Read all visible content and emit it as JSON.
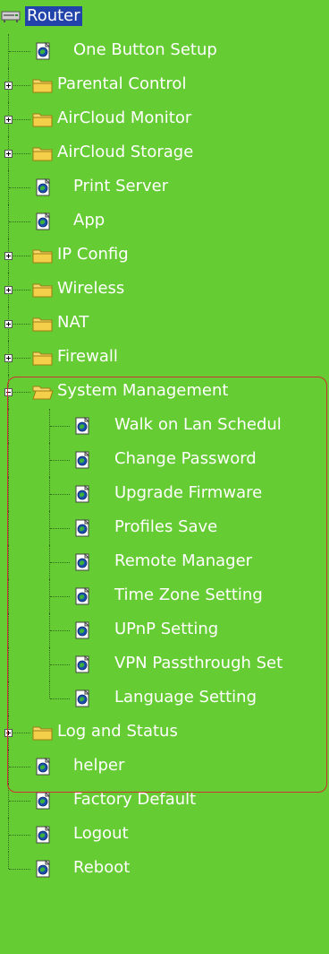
{
  "tree": {
    "root_label": "Router",
    "items": [
      {
        "label": "One Button Setup",
        "type": "page",
        "level": 1
      },
      {
        "label": "Parental Control",
        "type": "folder",
        "level": 1,
        "expanded": false
      },
      {
        "label": "AirCloud Monitor",
        "type": "folder",
        "level": 1,
        "expanded": false
      },
      {
        "label": "AirCloud Storage",
        "type": "folder",
        "level": 1,
        "expanded": false
      },
      {
        "label": "Print Server",
        "type": "page",
        "level": 1
      },
      {
        "label": "App",
        "type": "page",
        "level": 1
      },
      {
        "label": "IP Config",
        "type": "folder",
        "level": 1,
        "expanded": false
      },
      {
        "label": "Wireless",
        "type": "folder",
        "level": 1,
        "expanded": false
      },
      {
        "label": "NAT",
        "type": "folder",
        "level": 1,
        "expanded": false
      },
      {
        "label": "Firewall",
        "type": "folder",
        "level": 1,
        "expanded": false
      },
      {
        "label": "System Management",
        "type": "folder",
        "level": 1,
        "expanded": true
      },
      {
        "label": "Walk on Lan Schedul",
        "type": "page",
        "level": 2
      },
      {
        "label": "Change Password",
        "type": "page",
        "level": 2
      },
      {
        "label": "Upgrade Firmware",
        "type": "page",
        "level": 2
      },
      {
        "label": "Profiles Save",
        "type": "page",
        "level": 2
      },
      {
        "label": "Remote Manager",
        "type": "page",
        "level": 2
      },
      {
        "label": "Time Zone Setting",
        "type": "page",
        "level": 2
      },
      {
        "label": "UPnP Setting",
        "type": "page",
        "level": 2
      },
      {
        "label": "VPN Passthrough Set",
        "type": "page",
        "level": 2
      },
      {
        "label": "Language Setting",
        "type": "page",
        "level": 2
      },
      {
        "label": "Log and Status",
        "type": "folder",
        "level": 1,
        "expanded": false
      },
      {
        "label": "helper",
        "type": "page",
        "level": 1
      },
      {
        "label": "Factory Default",
        "type": "page",
        "level": 1
      },
      {
        "label": "Logout",
        "type": "page",
        "level": 1
      },
      {
        "label": "Reboot",
        "type": "page",
        "level": 1
      }
    ]
  },
  "colors": {
    "background": "#66cc33",
    "text": "#ffffff",
    "selected_bg": "#2244aa",
    "highlight_border": "#cc3333"
  }
}
